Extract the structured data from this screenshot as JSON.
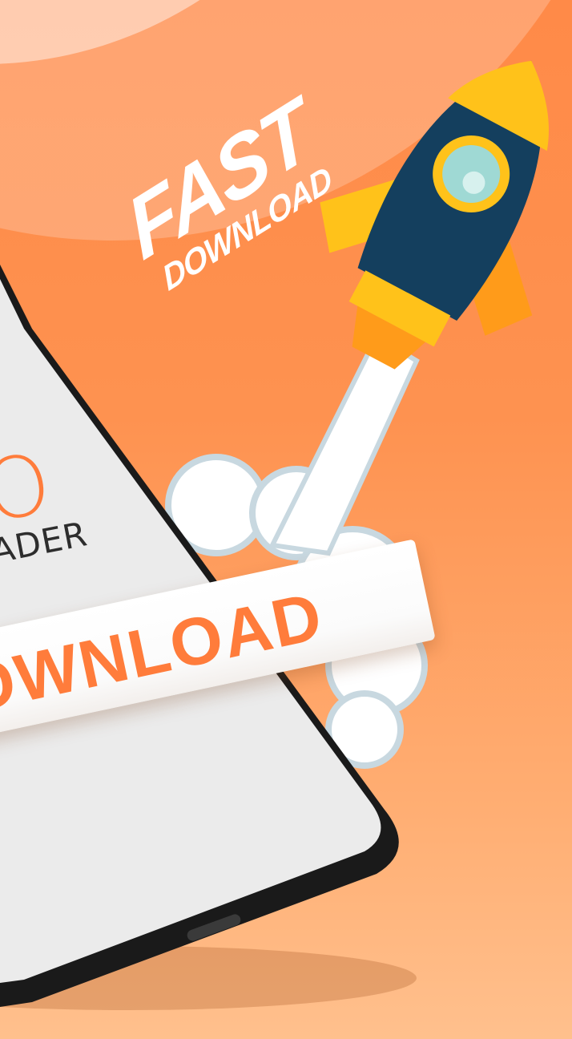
{
  "banner": {
    "headline_top": "FAST",
    "headline_bottom": "DOWNLOAD"
  },
  "phone_screen": {
    "logo_large": "EO",
    "logo_small": "LOADER"
  },
  "download_bar": {
    "label": "OWNLOAD"
  },
  "colors": {
    "background": "#ff8a48",
    "accent": "#ff7c3b",
    "rocket_body": "#143f5e",
    "rocket_fin": "#ffc21a"
  },
  "icons": [
    "rocket-icon",
    "smoke-cloud-icon",
    "phone-device"
  ]
}
